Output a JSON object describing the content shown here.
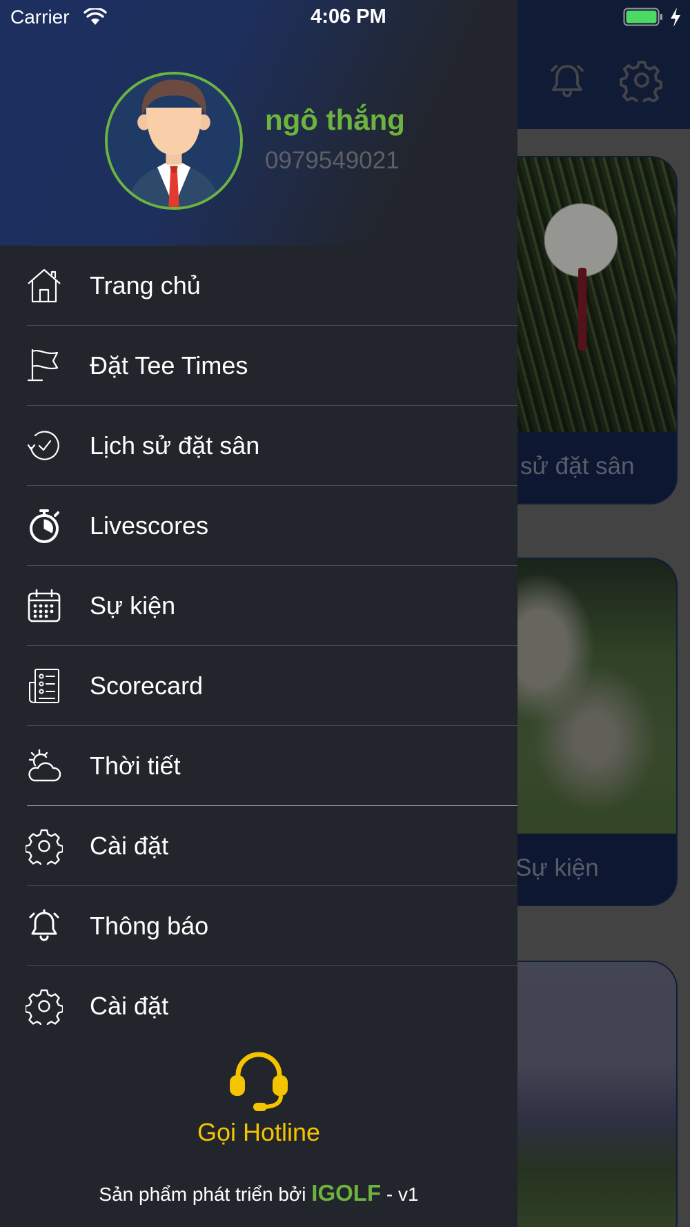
{
  "status_bar": {
    "carrier": "Carrier",
    "time": "4:06 PM"
  },
  "profile": {
    "name": "ngô thắng",
    "phone": "0979549021"
  },
  "menu": {
    "items": [
      {
        "label": "Trang chủ",
        "icon": "home-icon"
      },
      {
        "label": "Đặt Tee Times",
        "icon": "flag-icon"
      },
      {
        "label": "Lịch sử đặt sân",
        "icon": "history-icon"
      },
      {
        "label": "Livescores",
        "icon": "stopwatch-icon"
      },
      {
        "label": "Sự kiện",
        "icon": "calendar-icon"
      },
      {
        "label": "Scorecard",
        "icon": "scorecard-icon"
      },
      {
        "label": "Thời tiết",
        "icon": "weather-icon"
      },
      {
        "label": "Cài đặt",
        "icon": "gear-icon"
      },
      {
        "label": "Thông báo",
        "icon": "bell-icon"
      },
      {
        "label": "Cài đặt",
        "icon": "gear-icon"
      }
    ]
  },
  "hotline": {
    "label": "Gọi Hotline",
    "icon": "headset-icon"
  },
  "footer": {
    "prefix": "Sản phẩm phát triển bởi ",
    "brand": "IGOLF",
    "suffix": " - v1"
  },
  "background": {
    "cards": [
      {
        "caption": "sử đặt sân"
      },
      {
        "caption": "Sự kiện"
      },
      {
        "caption": ""
      }
    ]
  },
  "colors": {
    "accent_green": "#6db33f",
    "hotline_yellow": "#f5c400",
    "drawer_bg": "#22252b",
    "header_navy": "#1c2f5f"
  }
}
